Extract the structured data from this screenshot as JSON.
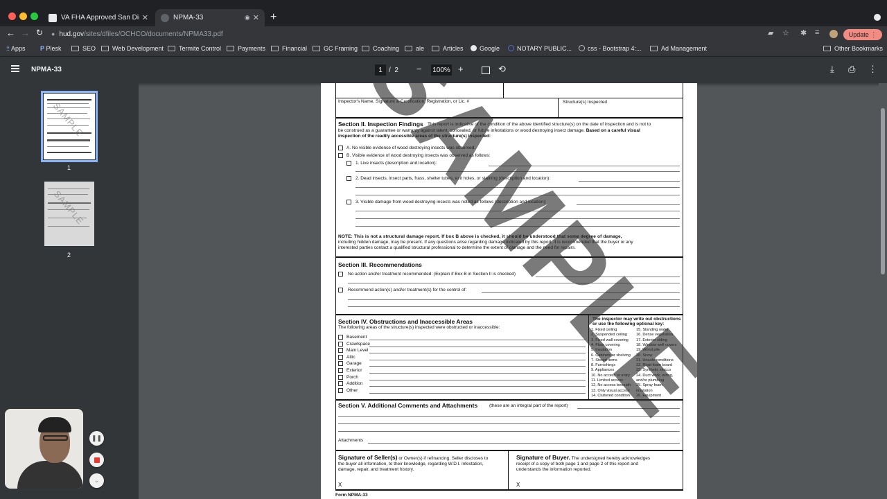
{
  "tabs": [
    {
      "title": "VA FHA Approved San Diego T",
      "active": false
    },
    {
      "title": "NPMA-33",
      "active": true
    }
  ],
  "omnibox": {
    "host": "hud.gov",
    "path": "/sites/dfiles/OCHCO/documents/NPMA33.pdf"
  },
  "update_label": "Update",
  "bookmarks": [
    "Apps",
    "Plesk",
    "SEO",
    "Web Development",
    "Termite Control",
    "Payments",
    "Financial",
    "GC Framing",
    "Coaching",
    "ale",
    "Articles",
    "Google",
    "NOTARY PUBLIC...",
    "css - Bootstrap 4:...",
    "Ad Management"
  ],
  "other_bookmarks": "Other Bookmarks",
  "viewer": {
    "title": "NPMA-33",
    "page": "1",
    "page_sep": "/",
    "page_total": "2",
    "zoom": "100%"
  },
  "thumbnails": [
    {
      "label": "1"
    },
    {
      "label": "2"
    }
  ],
  "thumb_watermark": "SAMPLE",
  "document": {
    "watermark": "SAMPLE",
    "inspector_label": "Inspector's Name, Signature & Certification, Registration, or Lic. #",
    "structures_label": "Structure(s) Inspected",
    "sec2_title": "Section II. Inspection Findings",
    "sec2_intro_a": "This report is indicative of the condition of the above identified structure(s) on the date of inspection and is not to",
    "sec2_intro_b": "be construed as a guarantee or warranty against latent, concealed, or future infestations or wood destroying insect damage.",
    "sec2_intro_bold": "Based on a careful visual",
    "sec2_intro_c": "inspection of the readily accessible areas of the structure(s) inspected:",
    "item_a": "A. No visible evidence of wood destroying insects was observed.",
    "item_b": "B. Visible evidence of wood destroying insects was observed as follows:",
    "item_b1": "1. Live insects (description and location):",
    "item_b2": "2. Dead insects, insect parts, frass, shelter tubes, exit holes, or staining (description and location):",
    "item_b3": "3. Visible damage from wood destroying insects was noted as follows (description and location):",
    "note_a": "NOTE: This is not a structural damage report. If box B above is checked, it should be understood that some degree of damage,",
    "note_b": "including hidden damage, may be present. If any questions arise regarding damage indicated by this report, it is recommended that the buyer or any",
    "note_c": "interested parties contact a qualified structural professional to determine the extent of damage and the need for repairs.",
    "sec3_title": "Section III. Recommendations",
    "rec_1": "No action and/or treatment recommended: (Explain if Box B in Section II is checked)",
    "rec_2": "Recommend action(s) and/or treatment(s) for the control of:",
    "sec4_title": "Section IV. Obstructions and Inaccessible Areas",
    "sec4_intro": "The following areas of the structure(s) inspected were obstructed or inaccessible:",
    "areas": [
      "Basement",
      "Crawlspace",
      "Main Level",
      "Attic",
      "Garage",
      "Exterior",
      "Porch",
      "Addition",
      "Other"
    ],
    "key_title_a": "The inspector may write out obstructions",
    "key_title_b": "or use the following optional key:",
    "key_left": [
      "1. Fixed ceiling",
      "2. Suspended ceiling",
      "3. Fixed wall covering",
      "4. Floor covering",
      "5. Insulation",
      "6. Cabinets or shelving",
      "7. Stored items",
      "8. Furnishings",
      "9. Appliances",
      "10. No access or entry",
      "11. Limited access",
      "12. No access beneath",
      "13. Only visual access",
      "14. Cluttered condition"
    ],
    "key_right": [
      "15. Standing water",
      "16. Dense vegetation",
      "17. Exterior siding",
      "18. Window well covers",
      "19. Wood pile",
      "20. Snow",
      "21. Unsafe conditions",
      "22. Rigid foam board",
      "23. Synthetic stucco",
      "24. Duct work, wiring,",
      "and/or plumbing",
      "25. Spray foam",
      "insulation",
      "26. Equipment"
    ],
    "sec5_title": "Section V. Additional Comments and Attachments",
    "sec5_note": "(these are an integral part of the report)",
    "attachments": "Attachments",
    "seller_title": "Signature of Seller(s)",
    "seller_a": "or Owner(s) if refinancing. Seller discloses to",
    "seller_b": "the buyer all information, to their knowledge, regarding W.D.I. infestation,",
    "seller_c": "damage, repair, and treatment history.",
    "buyer_title": "Signature of Buyer.",
    "buyer_a": "The undersigned hereby acknowledges",
    "buyer_b": "receipt of a copy of both page 1 and page 2 of this report and",
    "buyer_c": "understands the information reported.",
    "sign_x": "X",
    "footer": "Form NPMA-33"
  }
}
